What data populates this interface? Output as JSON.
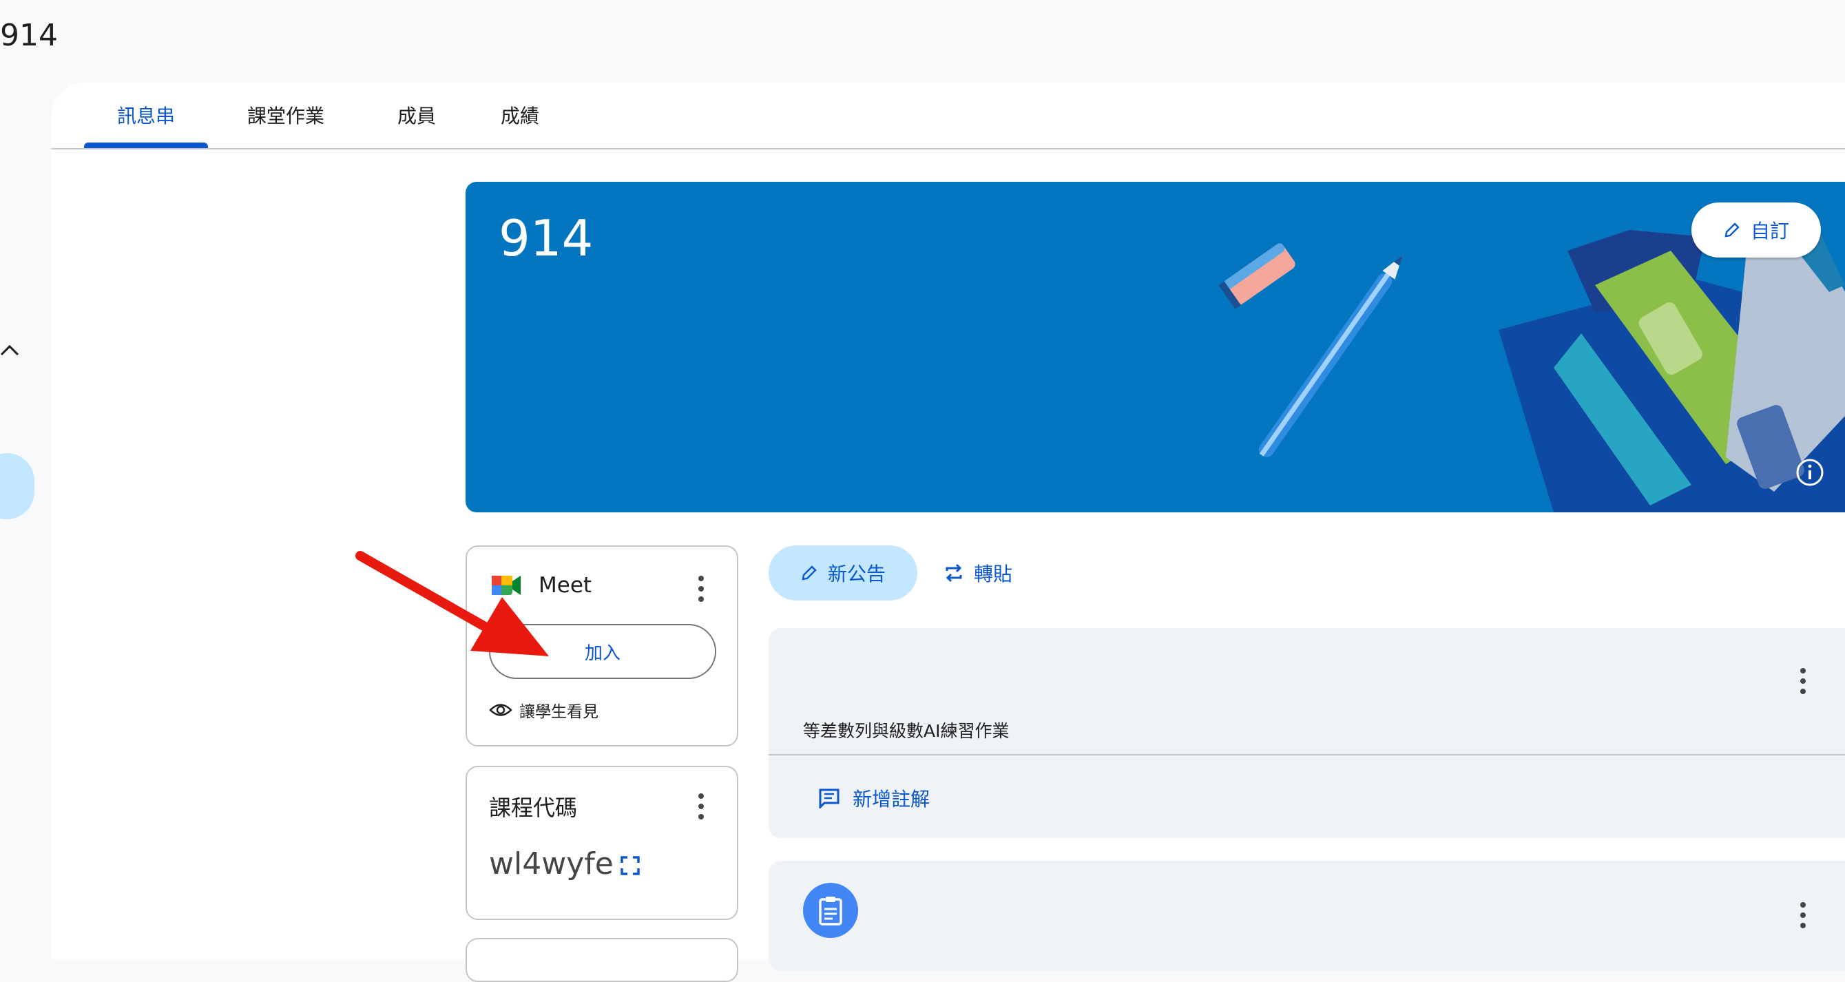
{
  "window": {
    "title": "914"
  },
  "tabs": [
    {
      "label": "訊息串",
      "active": true
    },
    {
      "label": "課堂作業",
      "active": false
    },
    {
      "label": "成員",
      "active": false
    },
    {
      "label": "成績",
      "active": false
    }
  ],
  "banner": {
    "title": "914",
    "customize_label": "自訂",
    "color": "#0476bf"
  },
  "meet": {
    "name": "Meet",
    "join_label": "加入",
    "visibility_label": "讓學生看見"
  },
  "class_code": {
    "title": "課程代碼",
    "code": "wl4wyfe"
  },
  "stream_actions": {
    "announce_label": "新公告",
    "repost_label": "轉貼"
  },
  "posts": [
    {
      "title": "等差數列與級數AI練習作業",
      "comment_label": "新增註解"
    }
  ],
  "colors": {
    "accent": "#0b57d0",
    "pill": "#c2e7ff",
    "card_bg": "#eff2f7",
    "annotation_arrow": "#e8190f"
  },
  "icons": [
    "chevron-up-icon",
    "pencil-icon",
    "info-icon",
    "meet-logo-icon",
    "more-vert-icon",
    "eye-icon",
    "expand-icon",
    "repost-icon",
    "comment-icon",
    "assignment-icon"
  ]
}
